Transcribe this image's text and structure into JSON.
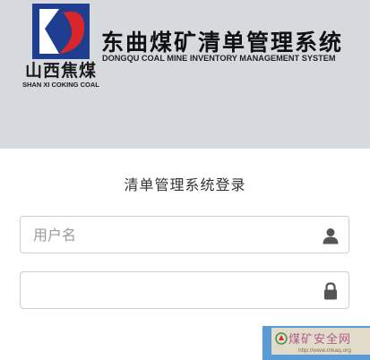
{
  "header": {
    "brand_cn": "山西焦煤",
    "brand_en": "SHAN XI COKING COAL",
    "title_cn": "东曲煤矿清单管理系统",
    "title_en": "DONGQU COAL MINE INVENTORY MANAGEMENT SYSTEM"
  },
  "login": {
    "title": "清单管理系统登录",
    "username_placeholder": "用户名",
    "username_value": "",
    "password_value": "",
    "button_label": ""
  },
  "watermark": {
    "text": "煤矿安全网",
    "url": "http://www.mkaq.org"
  },
  "icons": {
    "logo": "shanxi-coking-coal-logo",
    "username": "user-icon",
    "password": "lock-icon"
  },
  "colors": {
    "header_bg": "#d6d9dd",
    "logo_blue": "#1f3e8f",
    "logo_red": "#d9262b",
    "button_blue": "#5b9bd5"
  }
}
